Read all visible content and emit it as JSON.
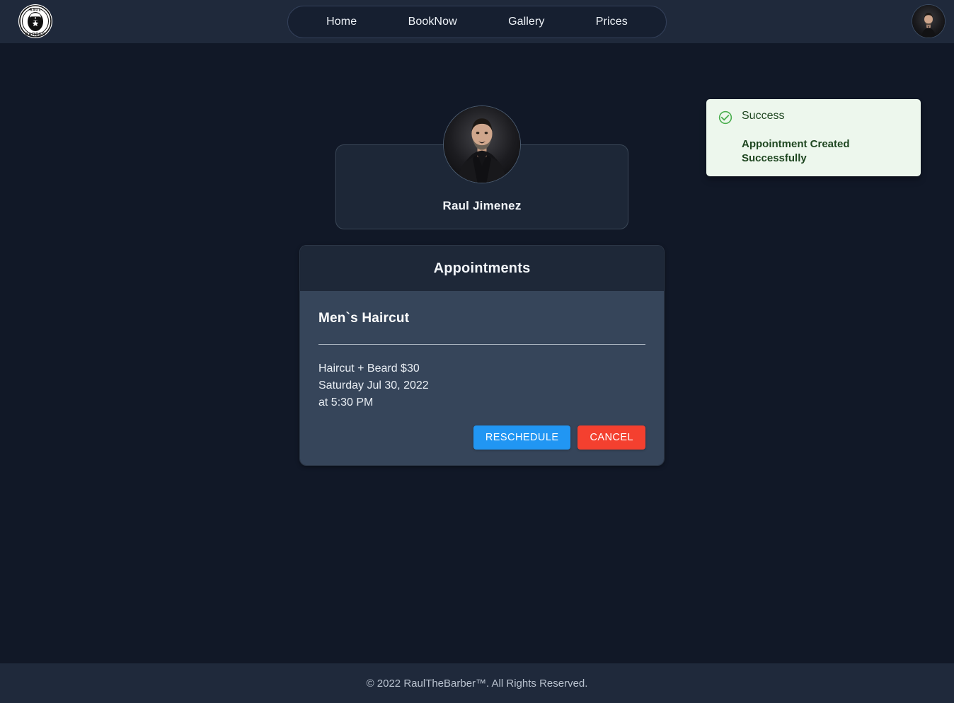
{
  "header": {
    "logo": {
      "icon": "barber-logo-icon",
      "top_text": "RAUL",
      "bottom_text": "BARBER"
    },
    "nav": [
      {
        "label": "Home",
        "name": "nav-link-home"
      },
      {
        "label": "BookNow",
        "name": "nav-link-booknow"
      },
      {
        "label": "Gallery",
        "name": "nav-link-gallery"
      },
      {
        "label": "Prices",
        "name": "nav-link-prices"
      }
    ],
    "user_avatar": {
      "icon": "user-avatar-photo"
    }
  },
  "toast": {
    "icon": "check-circle-icon",
    "title": "Success",
    "message": "Appointment Created Successfully",
    "bg_color": "#edf7ed",
    "text_color": "#1e4620",
    "icon_color": "#4caf50"
  },
  "profile": {
    "name": "Raul Jimenez",
    "photo_icon": "barber-portrait-photo"
  },
  "appointments": {
    "title": "Appointments",
    "items": [
      {
        "service": "Men`s Haircut",
        "details": "Haircut + Beard $30",
        "date": "Saturday Jul 30, 2022",
        "time": "at 5:30 PM",
        "reschedule_label": "RESCHEDULE",
        "cancel_label": "CANCEL"
      }
    ]
  },
  "footer": {
    "text": "© 2022 RaulTheBarber™. All Rights Reserved."
  },
  "colors": {
    "page_bg": "#111827",
    "bar_bg": "#1f293b",
    "card_header_bg": "#1e2838",
    "card_body_bg": "#36455a",
    "primary": "#2196f3",
    "danger": "#f4402f"
  }
}
